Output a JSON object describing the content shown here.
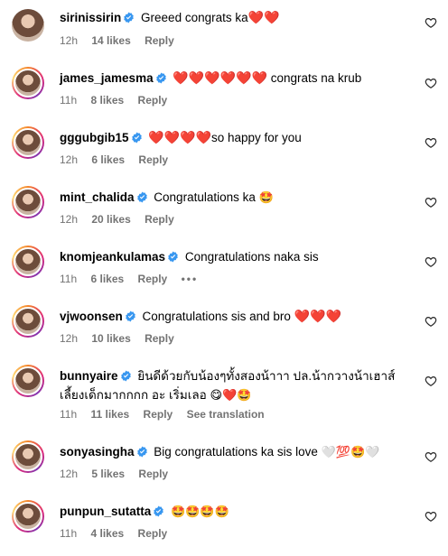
{
  "comments": [
    {
      "username": "sirinissirin",
      "text": "Greeed congrats ka",
      "suffix": "❤️❤️",
      "time": "12h",
      "likes": "14 likes",
      "reply": "Reply",
      "story": false
    },
    {
      "username": "james_jamesma",
      "text": "",
      "prefix": "❤️❤️❤️❤️❤️❤️",
      "suffix_text": " congrats na krub",
      "time": "11h",
      "likes": "8 likes",
      "reply": "Reply",
      "story": true
    },
    {
      "username": "gggubgib15",
      "text": "",
      "prefix": "❤️❤️❤️❤️",
      "suffix_text": "so happy for you",
      "time": "12h",
      "likes": "6 likes",
      "reply": "Reply",
      "story": true
    },
    {
      "username": "mint_chalida",
      "text": "Congratulations ka ",
      "suffix": "🤩",
      "time": "12h",
      "likes": "20 likes",
      "reply": "Reply",
      "story": true
    },
    {
      "username": "knomjeankulamas",
      "text": "Congratulations naka sis",
      "time": "11h",
      "likes": "6 likes",
      "reply": "Reply",
      "more": "•••",
      "story": true
    },
    {
      "username": "vjwoonsen",
      "text": "Congratulations sis and bro ",
      "suffix": "❤️❤️❤️",
      "time": "12h",
      "likes": "10 likes",
      "reply": "Reply",
      "story": true
    },
    {
      "username": "bunnyaire",
      "text": "ยินดีด้วยกับน้องๆทั้งสองน้าาา ปล.น้ากวางน้าเฮาส์เลี้ยงเด็กมากกกก อะ เริ่มเลอ ",
      "suffix": "😋❤️🤩",
      "time": "11h",
      "likes": "11 likes",
      "reply": "Reply",
      "translate": "See translation",
      "story": true
    },
    {
      "username": "sonyasingha",
      "text": "Big congratulations ka sis love ",
      "suffix": "🤍💯🤩🤍",
      "time": "12h",
      "likes": "5 likes",
      "reply": "Reply",
      "story": true
    },
    {
      "username": "punpun_sutatta",
      "text": "",
      "suffix": "🤩🤩🤩🤩",
      "time": "11h",
      "likes": "4 likes",
      "reply": "Reply",
      "story": true
    }
  ]
}
